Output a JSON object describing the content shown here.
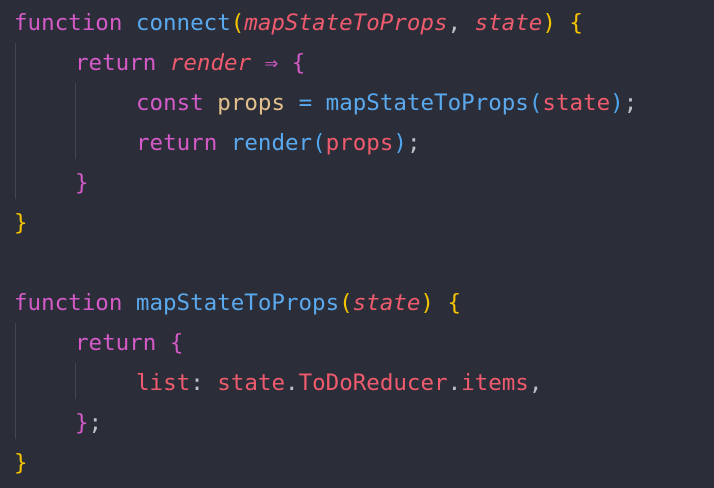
{
  "code_lines": [
    {
      "tokens": [
        {
          "t": "function",
          "c": "kw"
        },
        {
          "t": " ",
          "c": ""
        },
        {
          "t": "connect",
          "c": "fn"
        },
        {
          "t": "(",
          "c": "br1"
        },
        {
          "t": "mapStateToProps",
          "c": "par it"
        },
        {
          "t": ", ",
          "c": "dim"
        },
        {
          "t": "state",
          "c": "par it"
        },
        {
          "t": ")",
          "c": "br1"
        },
        {
          "t": " ",
          "c": ""
        },
        {
          "t": "{",
          "c": "br1"
        }
      ]
    },
    {
      "indent": 1,
      "tokens": [
        {
          "t": "return",
          "c": "kw"
        },
        {
          "t": " ",
          "c": ""
        },
        {
          "t": "render",
          "c": "par it"
        },
        {
          "t": " ",
          "c": ""
        },
        {
          "t": "⇒",
          "c": "kw"
        },
        {
          "t": " ",
          "c": ""
        },
        {
          "t": "{",
          "c": "br2"
        }
      ]
    },
    {
      "indent": 2,
      "tokens": [
        {
          "t": "const",
          "c": "kw"
        },
        {
          "t": " ",
          "c": ""
        },
        {
          "t": "props",
          "c": "var"
        },
        {
          "t": " ",
          "c": ""
        },
        {
          "t": "=",
          "c": "op"
        },
        {
          "t": " ",
          "c": ""
        },
        {
          "t": "mapStateToProps",
          "c": "fn"
        },
        {
          "t": "(",
          "c": "br3"
        },
        {
          "t": "state",
          "c": "par"
        },
        {
          "t": ")",
          "c": "br3"
        },
        {
          "t": ";",
          "c": "dim"
        }
      ]
    },
    {
      "indent": 2,
      "tokens": [
        {
          "t": "return",
          "c": "kw"
        },
        {
          "t": " ",
          "c": ""
        },
        {
          "t": "render",
          "c": "fn"
        },
        {
          "t": "(",
          "c": "br3"
        },
        {
          "t": "props",
          "c": "par"
        },
        {
          "t": ")",
          "c": "br3"
        },
        {
          "t": ";",
          "c": "dim"
        }
      ]
    },
    {
      "indent": 1,
      "tokens": [
        {
          "t": "}",
          "c": "br2"
        }
      ]
    },
    {
      "tokens": [
        {
          "t": "}",
          "c": "br1"
        }
      ]
    },
    {
      "tokens": []
    },
    {
      "tokens": [
        {
          "t": "function",
          "c": "kw"
        },
        {
          "t": " ",
          "c": ""
        },
        {
          "t": "mapStateToProps",
          "c": "fn"
        },
        {
          "t": "(",
          "c": "br1"
        },
        {
          "t": "state",
          "c": "par it"
        },
        {
          "t": ")",
          "c": "br1"
        },
        {
          "t": " ",
          "c": ""
        },
        {
          "t": "{",
          "c": "br1"
        }
      ]
    },
    {
      "indent": 1,
      "tokens": [
        {
          "t": "return",
          "c": "kw"
        },
        {
          "t": " ",
          "c": ""
        },
        {
          "t": "{",
          "c": "br2"
        }
      ]
    },
    {
      "indent": 2,
      "tokens": [
        {
          "t": "list",
          "c": "par"
        },
        {
          "t": ": ",
          "c": "dim"
        },
        {
          "t": "state",
          "c": "par"
        },
        {
          "t": ".",
          "c": "dim"
        },
        {
          "t": "ToDoReducer",
          "c": "prop"
        },
        {
          "t": ".",
          "c": "dim"
        },
        {
          "t": "items",
          "c": "prop"
        },
        {
          "t": ",",
          "c": "dim"
        }
      ]
    },
    {
      "indent": 1,
      "tokens": [
        {
          "t": "}",
          "c": "br2"
        },
        {
          "t": ";",
          "c": "dim"
        }
      ]
    },
    {
      "tokens": [
        {
          "t": "}",
          "c": "br1"
        }
      ]
    }
  ]
}
